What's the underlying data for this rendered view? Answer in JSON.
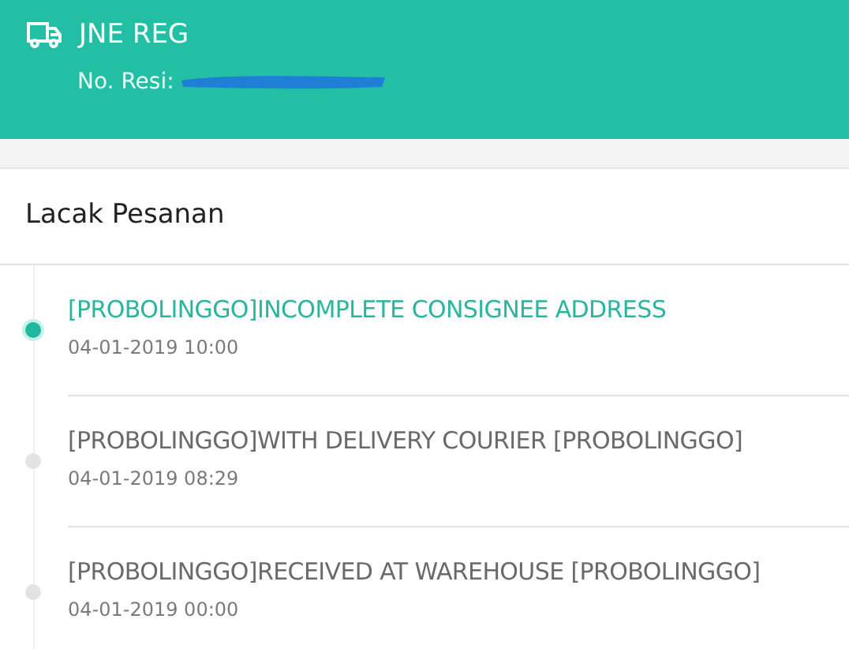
{
  "header": {
    "courier": "JNE REG",
    "resi_label": "No. Resi:"
  },
  "section": {
    "title": "Lacak Pesanan"
  },
  "events": [
    {
      "status": "[PROBOLINGGO]INCOMPLETE CONSIGNEE ADDRESS",
      "time": "04-01-2019 10:00",
      "active": true
    },
    {
      "status": "[PROBOLINGGO]WITH DELIVERY COURIER [PROBOLINGGO]",
      "time": "04-01-2019 08:29",
      "active": false
    },
    {
      "status": "[PROBOLINGGO]RECEIVED AT WAREHOUSE [PROBOLINGGO]",
      "time": "04-01-2019 00:00",
      "active": false
    }
  ]
}
